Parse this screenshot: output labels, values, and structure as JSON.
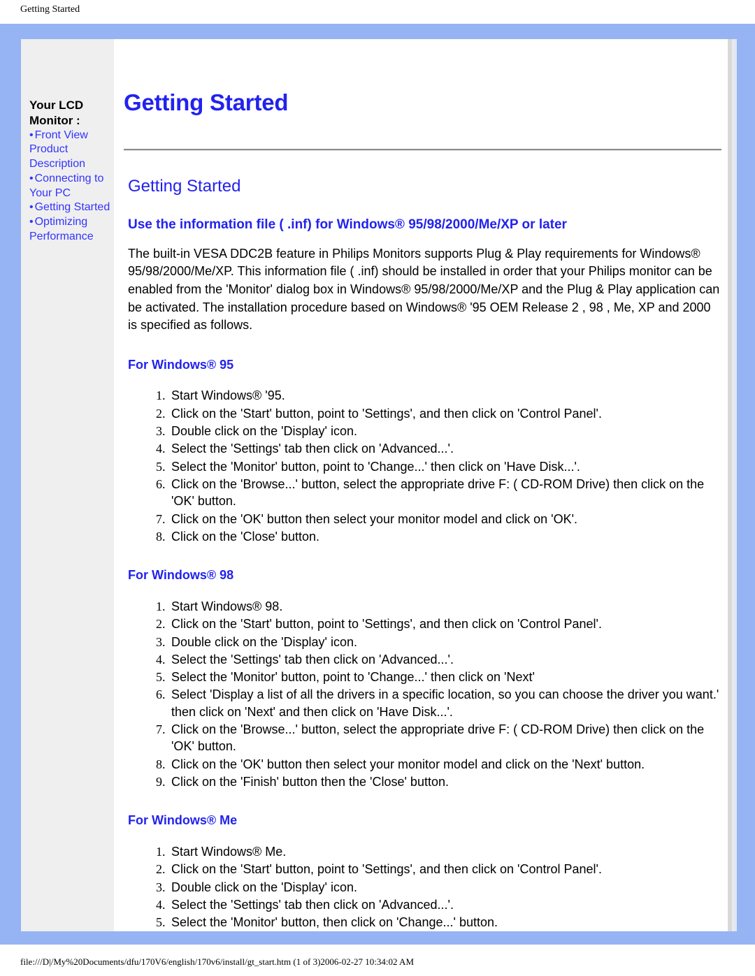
{
  "document": {
    "header_title": "Getting Started",
    "footer_path": "file:///D|/My%20Documents/dfu/170V6/english/170v6/install/gt_start.htm (1 of 3)2006-02-27 10:34:02 AM"
  },
  "colors": {
    "frame_blue": "#96b4f4",
    "link_blue": "#3333ff",
    "heading_blue": "#2222ee",
    "sidebar_gray": "#efefef"
  },
  "sidebar": {
    "title_line1": "Your LCD",
    "title_line2": "Monitor :",
    "bullet": "•",
    "items": [
      {
        "label": "Front View Product Description"
      },
      {
        "label": "Connecting to Your PC"
      },
      {
        "label": "Getting Started"
      },
      {
        "label": "Optimizing Performance"
      }
    ]
  },
  "main": {
    "page_title": "Getting Started",
    "section_title": "Getting Started",
    "subsection_title": "Use the information file ( .inf) for Windows® 95/98/2000/Me/XP or later",
    "intro_paragraph": "The built-in VESA DDC2B feature in Philips Monitors supports Plug & Play requirements for Windows® 95/98/2000/Me/XP. This information file ( .inf) should be installed in order that your Philips monitor can be enabled from the 'Monitor' dialog box in Windows® 95/98/2000/Me/XP and the Plug & Play application can be activated. The installation procedure based on Windows® '95 OEM Release 2 , 98 , Me, XP and 2000 is specified as follows.",
    "os_sections": [
      {
        "heading": "For Windows® 95",
        "steps": [
          "Start Windows® '95.",
          "Click on the 'Start' button, point to 'Settings', and then click on 'Control Panel'.",
          "Double click on the 'Display' icon.",
          "Select the 'Settings' tab then click on 'Advanced...'.",
          "Select the 'Monitor' button, point to 'Change...' then click on 'Have Disk...'.",
          "Click on the 'Browse...' button, select the appropriate drive F: ( CD-ROM Drive) then click on the 'OK' button.",
          "Click on the 'OK' button then select your monitor model and click on 'OK'.",
          "Click on the 'Close' button."
        ]
      },
      {
        "heading": "For Windows® 98",
        "steps": [
          "Start Windows® 98.",
          "Click on the 'Start' button, point to 'Settings', and then click on 'Control Panel'.",
          "Double click on the 'Display' icon.",
          "Select the 'Settings' tab then click on 'Advanced...'.",
          "Select the 'Monitor' button, point to 'Change...' then click on 'Next'",
          "Select 'Display a list of all the drivers in a specific location, so you can choose the driver you want.' then click on 'Next' and then click on 'Have Disk...'.",
          "Click on the 'Browse...' button, select the appropriate drive F: ( CD-ROM Drive) then click on the 'OK' button.",
          "Click on the 'OK' button then select your monitor model and click on the 'Next' button.",
          "Click on the 'Finish' button then the 'Close' button."
        ]
      },
      {
        "heading": "For Windows® Me",
        "steps": [
          "Start Windows® Me.",
          "Click on the 'Start' button, point to 'Settings', and then click on 'Control Panel'.",
          "Double click on the 'Display' icon.",
          "Select the 'Settings' tab then click on 'Advanced...'.",
          "Select the 'Monitor' button, then click on 'Change...' button."
        ]
      }
    ]
  }
}
